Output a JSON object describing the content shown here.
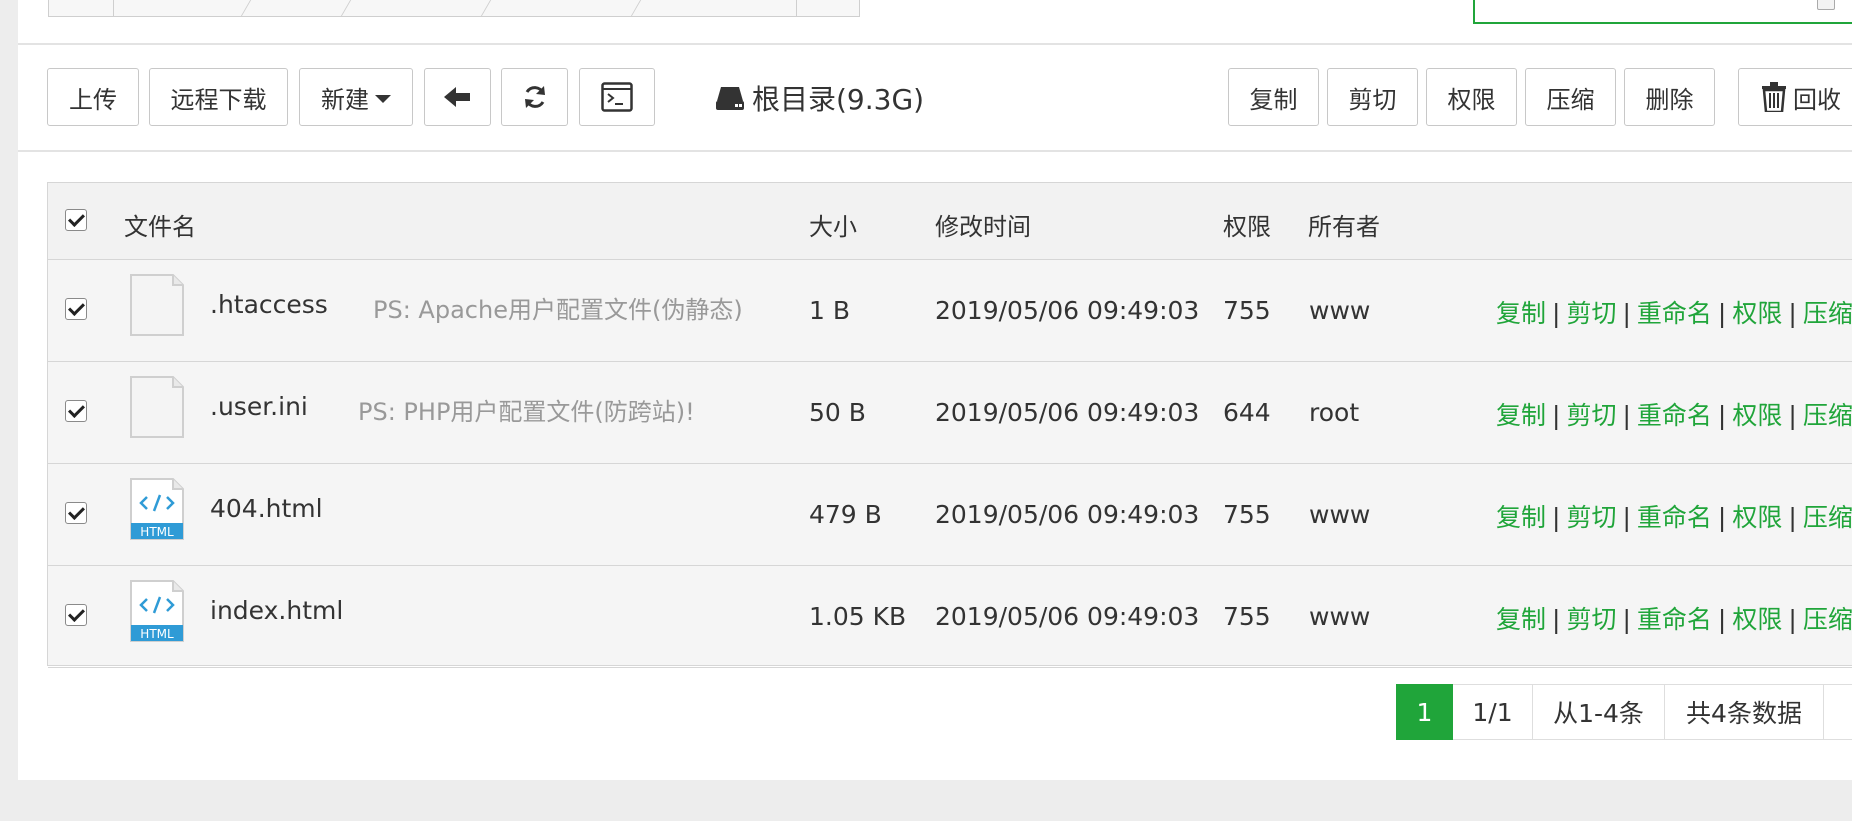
{
  "toolbar": {
    "upload": "上传",
    "remote_download": "远程下载",
    "new": "新建",
    "root_label": "根目录(9.3G)",
    "copy": "复制",
    "cut": "剪切",
    "permission": "权限",
    "compress": "压缩",
    "delete": "删除",
    "recycle": "回收"
  },
  "table": {
    "headers": {
      "filename": "文件名",
      "size": "大小",
      "modified": "修改时间",
      "permission": "权限",
      "owner": "所有者"
    },
    "rows": [
      {
        "name": ".htaccess",
        "ps": "PS: Apache用户配置文件(伪静态)",
        "size": "1 B",
        "modified": "2019/05/06 09:49:03",
        "perm": "755",
        "owner": "www",
        "icon": "blank-file-icon"
      },
      {
        "name": ".user.ini",
        "ps": "PS: PHP用户配置文件(防跨站)!",
        "size": "50 B",
        "modified": "2019/05/06 09:49:03",
        "perm": "644",
        "owner": "root",
        "icon": "blank-file-icon"
      },
      {
        "name": "404.html",
        "ps": "",
        "size": "479 B",
        "modified": "2019/05/06 09:49:03",
        "perm": "755",
        "owner": "www",
        "icon": "html-file-icon"
      },
      {
        "name": "index.html",
        "ps": "",
        "size": "1.05 KB",
        "modified": "2019/05/06 09:49:03",
        "perm": "755",
        "owner": "www",
        "icon": "html-file-icon"
      }
    ],
    "row_ops": {
      "copy": "复制",
      "cut": "剪切",
      "rename": "重命名",
      "permission": "权限",
      "compress": "压缩",
      "separator": "|"
    },
    "html_badge": "HTML"
  },
  "pagination": {
    "current": "1",
    "pages": "1/1",
    "range": "从1-4条",
    "total": "共4条数据"
  },
  "colors": {
    "accent": "#20a53a",
    "ps_text": "#999999"
  }
}
